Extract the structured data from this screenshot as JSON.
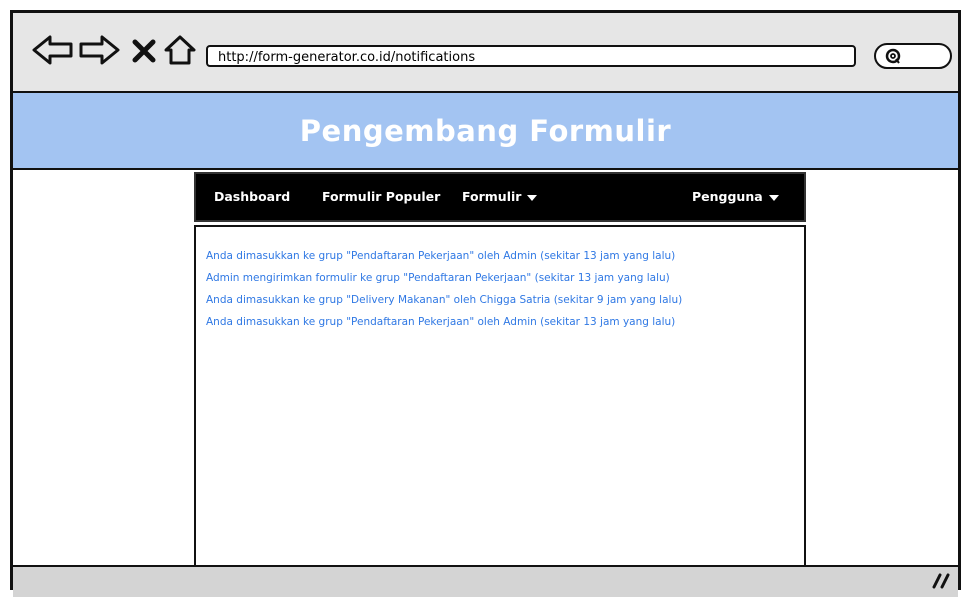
{
  "browser": {
    "url": "http://form-generator.co.id/notifications"
  },
  "header": {
    "title": "Pengembang Formulir"
  },
  "nav": {
    "items": [
      {
        "label": "Dashboard"
      },
      {
        "label": "Formulir Populer"
      },
      {
        "label": "Formulir"
      },
      {
        "label": "Pengguna"
      }
    ]
  },
  "notifications": [
    "Anda dimasukkan ke grup \"Pendaftaran Pekerjaan\" oleh Admin (sekitar 13 jam yang lalu)",
    "Admin mengirimkan formulir ke grup \"Pendaftaran Pekerjaan\" (sekitar 13 jam yang lalu)",
    "Anda dimasukkan ke grup \"Delivery Makanan\" oleh Chigga Satria (sekitar 9 jam yang lalu)",
    "Anda dimasukkan ke grup \"Pendaftaran Pekerjaan\" oleh Admin (sekitar 13 jam yang lalu)"
  ],
  "colors": {
    "banner": "#a3c4f2",
    "link": "#2f78e4",
    "navbar": "#000000"
  }
}
